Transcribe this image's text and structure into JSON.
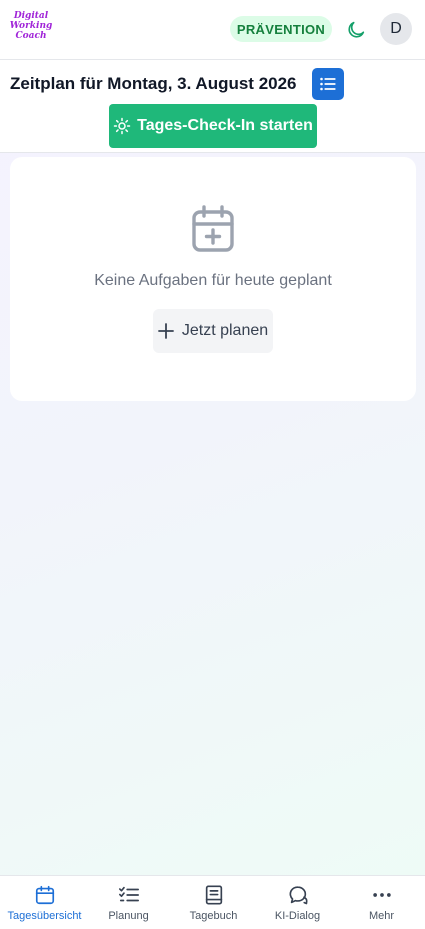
{
  "header": {
    "logo_lines": [
      "Digital",
      "Working",
      "Coach"
    ],
    "badge": "PRÄVENTION",
    "theme_icon": "moon-icon",
    "avatar_initial": "D"
  },
  "subheader": {
    "date_title": "Zeitplan für Montag, 3. August 2026",
    "list_icon": "list-icon",
    "checkin_label": "Tages-Check-In starten",
    "checkin_icon": "sun-icon"
  },
  "empty_state": {
    "icon": "calendar-plus-icon",
    "message": "Keine Aufgaben für heute geplant",
    "plan_label": "Jetzt planen",
    "plan_icon": "plus-icon"
  },
  "bottom_nav": {
    "items": [
      {
        "label": "Tagesübersicht",
        "icon": "calendar-icon",
        "active": true
      },
      {
        "label": "Planung",
        "icon": "checklist-icon",
        "active": false
      },
      {
        "label": "Tagebuch",
        "icon": "book-icon",
        "active": false
      },
      {
        "label": "KI-Dialog",
        "icon": "chat-icon",
        "active": false
      },
      {
        "label": "Mehr",
        "icon": "more-icon",
        "active": false
      }
    ]
  },
  "colors": {
    "brand": "#a024d8",
    "primary": "#1d6fd6",
    "success": "#1fb87a",
    "badge_bg": "#dcfce7",
    "badge_text": "#15803d"
  }
}
